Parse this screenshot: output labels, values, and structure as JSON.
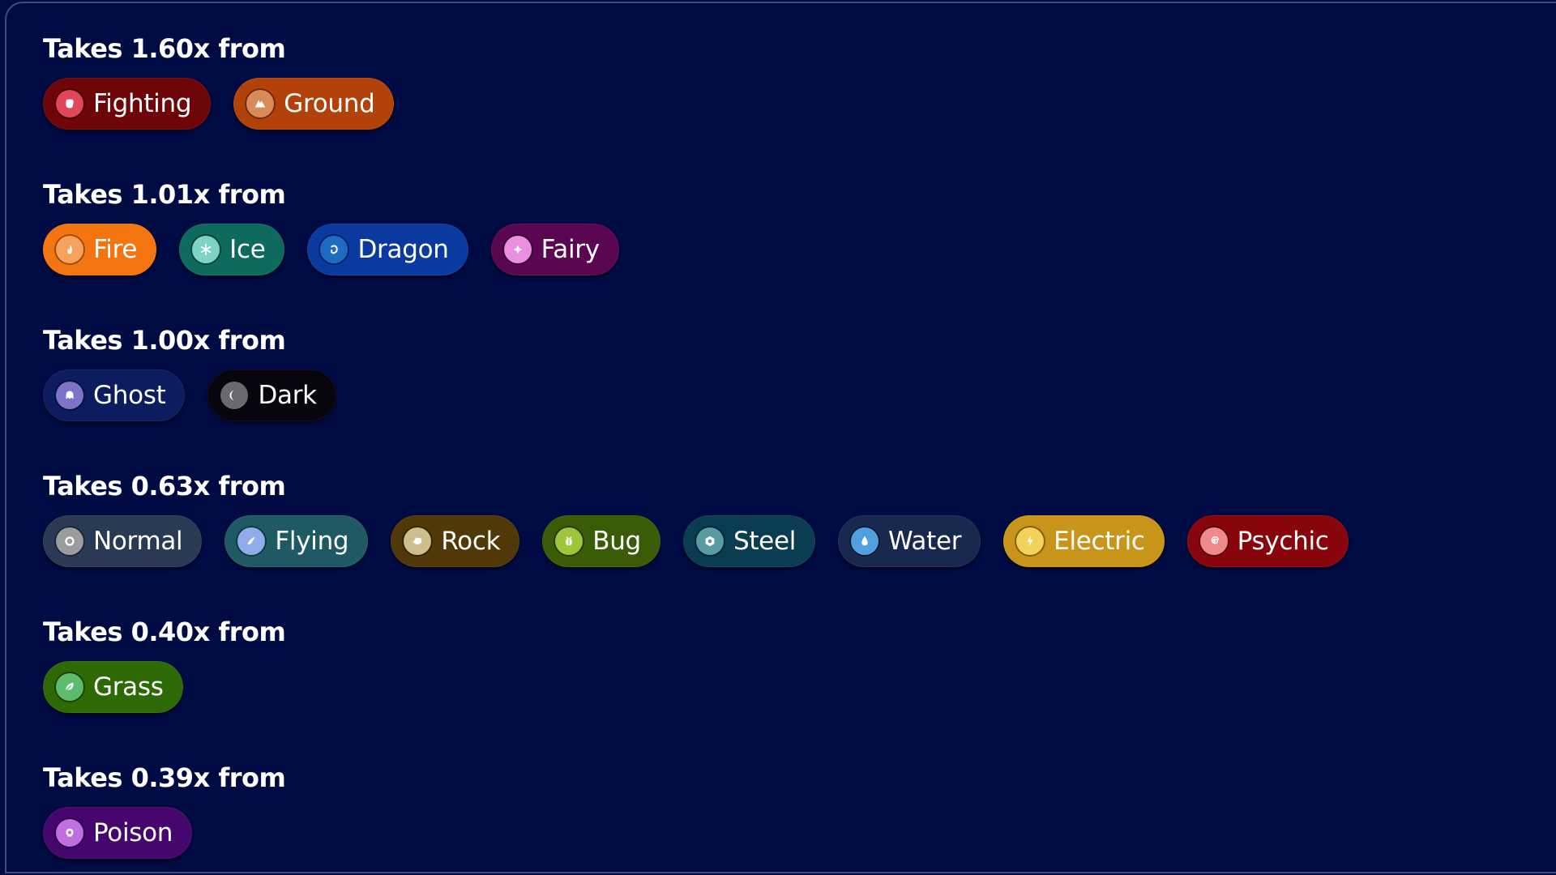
{
  "groups": [
    {
      "heading": "Takes 1.60x from",
      "multiplier": "1.60x",
      "types": [
        {
          "name": "Fighting",
          "icon": "fist-icon",
          "bg": "#6e0609",
          "iconBg": "#e0475a"
        },
        {
          "name": "Ground",
          "icon": "mountain-icon",
          "bg": "#b3420a",
          "iconBg": "#d98a5a"
        }
      ]
    },
    {
      "heading": "Takes 1.01x from",
      "multiplier": "1.01x",
      "types": [
        {
          "name": "Fire",
          "icon": "flame-icon",
          "bg": "#f4740f",
          "iconBg": "#f7a25c"
        },
        {
          "name": "Ice",
          "icon": "snowflake-icon",
          "bg": "#0e6a5c",
          "iconBg": "#7ed3c5"
        },
        {
          "name": "Dragon",
          "icon": "dragon-icon",
          "bg": "#0a3aa0",
          "iconBg": "#1d6cc2"
        },
        {
          "name": "Fairy",
          "icon": "sparkle-icon",
          "bg": "#5a0650",
          "iconBg": "#e98ee0"
        }
      ]
    },
    {
      "heading": "Takes 1.00x from",
      "multiplier": "1.00x",
      "types": [
        {
          "name": "Ghost",
          "icon": "ghost-icon",
          "bg": "#0c1c5e",
          "iconBg": "#7b74c8"
        },
        {
          "name": "Dark",
          "icon": "moon-icon",
          "bg": "#08050f",
          "iconBg": "#6b6874"
        }
      ]
    },
    {
      "heading": "Takes 0.63x from",
      "multiplier": "0.63x",
      "types": [
        {
          "name": "Normal",
          "icon": "circle-icon",
          "bg": "#2a3a55",
          "iconBg": "#9a9c9e"
        },
        {
          "name": "Flying",
          "icon": "wing-icon",
          "bg": "#1f5a64",
          "iconBg": "#90acea"
        },
        {
          "name": "Rock",
          "icon": "rock-icon",
          "bg": "#513808",
          "iconBg": "#cdbf8c"
        },
        {
          "name": "Bug",
          "icon": "bug-icon",
          "bg": "#3a5c06",
          "iconBg": "#9fc63a"
        },
        {
          "name": "Steel",
          "icon": "hexagon-nut-icon",
          "bg": "#0a3c52",
          "iconBg": "#5a9aa2"
        },
        {
          "name": "Water",
          "icon": "droplet-icon",
          "bg": "#19284e",
          "iconBg": "#509fe0"
        },
        {
          "name": "Electric",
          "icon": "bolt-icon",
          "bg": "#c8951a",
          "iconBg": "#f2d35a"
        },
        {
          "name": "Psychic",
          "icon": "spiral-icon",
          "bg": "#88050c",
          "iconBg": "#f08a8a"
        }
      ]
    },
    {
      "heading": "Takes 0.40x from",
      "multiplier": "0.40x",
      "types": [
        {
          "name": "Grass",
          "icon": "leaf-icon",
          "bg": "#2d6a06",
          "iconBg": "#5cbb6c"
        }
      ]
    },
    {
      "heading": "Takes 0.39x from",
      "multiplier": "0.39x",
      "types": [
        {
          "name": "Poison",
          "icon": "skull-icon",
          "bg": "#45066e",
          "iconBg": "#c16ee0"
        }
      ]
    }
  ]
}
